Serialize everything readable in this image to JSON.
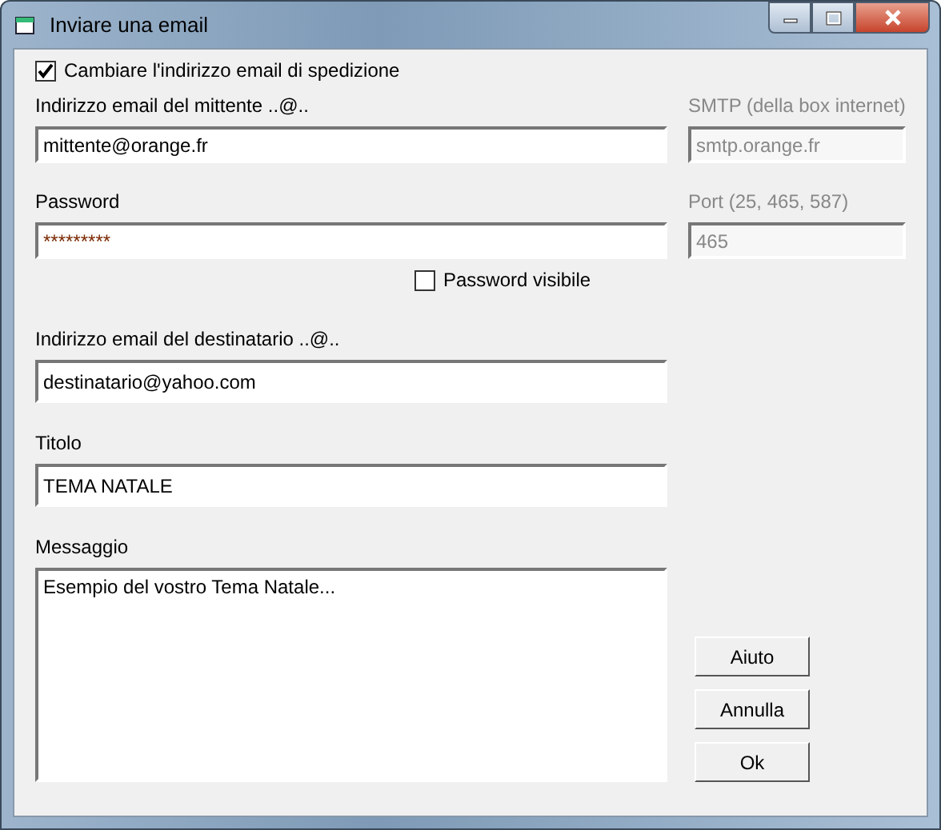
{
  "window": {
    "title": "Inviare una email"
  },
  "change_sender": {
    "label": "Cambiare l'indirizzo email di spedizione",
    "checked": true
  },
  "sender": {
    "label": "Indirizzo email del mittente ..@..",
    "value": "mittente@orange.fr"
  },
  "smtp": {
    "label": "SMTP (della box internet)",
    "value": "smtp.orange.fr",
    "disabled": true
  },
  "password": {
    "label": "Password",
    "value": "*********"
  },
  "port": {
    "label": "Port (25, 465, 587)",
    "value": "465",
    "disabled": true
  },
  "show_password": {
    "label": "Password visibile",
    "checked": false
  },
  "recipient": {
    "label": "Indirizzo email del destinatario ..@..",
    "value": "destinatario@yahoo.com"
  },
  "subject": {
    "label": "Titolo",
    "value": "TEMA NATALE"
  },
  "message": {
    "label": "Messaggio",
    "value": "Esempio del vostro Tema Natale..."
  },
  "buttons": [
    "Aiuto",
    "Annulla",
    "Ok"
  ]
}
